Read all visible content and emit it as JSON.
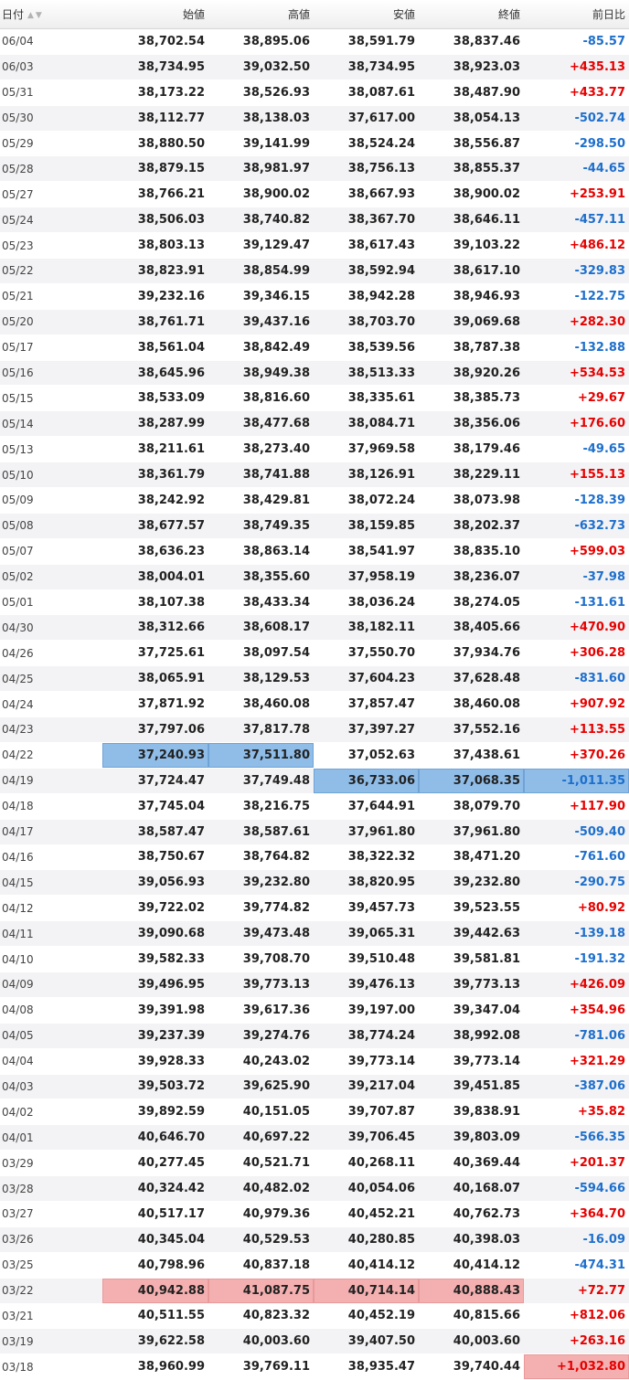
{
  "columns": {
    "date": "日付",
    "open": "始値",
    "high": "高値",
    "low": "安値",
    "close": "終値",
    "change": "前日比"
  },
  "icons": {
    "sort": "sort-up-down-icon"
  },
  "colors": {
    "positive": "#e60000",
    "negative": "#1e6fcc",
    "highlight_blue": "#8fbde8",
    "highlight_red": "#f4b0b0"
  },
  "rows": [
    {
      "date": "06/04",
      "open": "38,702.54",
      "high": "38,895.06",
      "low": "38,591.79",
      "close": "38,837.46",
      "change": "-85.57"
    },
    {
      "date": "06/03",
      "open": "38,734.95",
      "high": "39,032.50",
      "low": "38,734.95",
      "close": "38,923.03",
      "change": "+435.13"
    },
    {
      "date": "05/31",
      "open": "38,173.22",
      "high": "38,526.93",
      "low": "38,087.61",
      "close": "38,487.90",
      "change": "+433.77"
    },
    {
      "date": "05/30",
      "open": "38,112.77",
      "high": "38,138.03",
      "low": "37,617.00",
      "close": "38,054.13",
      "change": "-502.74"
    },
    {
      "date": "05/29",
      "open": "38,880.50",
      "high": "39,141.99",
      "low": "38,524.24",
      "close": "38,556.87",
      "change": "-298.50"
    },
    {
      "date": "05/28",
      "open": "38,879.15",
      "high": "38,981.97",
      "low": "38,756.13",
      "close": "38,855.37",
      "change": "-44.65"
    },
    {
      "date": "05/27",
      "open": "38,766.21",
      "high": "38,900.02",
      "low": "38,667.93",
      "close": "38,900.02",
      "change": "+253.91"
    },
    {
      "date": "05/24",
      "open": "38,506.03",
      "high": "38,740.82",
      "low": "38,367.70",
      "close": "38,646.11",
      "change": "-457.11"
    },
    {
      "date": "05/23",
      "open": "38,803.13",
      "high": "39,129.47",
      "low": "38,617.43",
      "close": "39,103.22",
      "change": "+486.12"
    },
    {
      "date": "05/22",
      "open": "38,823.91",
      "high": "38,854.99",
      "low": "38,592.94",
      "close": "38,617.10",
      "change": "-329.83"
    },
    {
      "date": "05/21",
      "open": "39,232.16",
      "high": "39,346.15",
      "low": "38,942.28",
      "close": "38,946.93",
      "change": "-122.75"
    },
    {
      "date": "05/20",
      "open": "38,761.71",
      "high": "39,437.16",
      "low": "38,703.70",
      "close": "39,069.68",
      "change": "+282.30"
    },
    {
      "date": "05/17",
      "open": "38,561.04",
      "high": "38,842.49",
      "low": "38,539.56",
      "close": "38,787.38",
      "change": "-132.88"
    },
    {
      "date": "05/16",
      "open": "38,645.96",
      "high": "38,949.38",
      "low": "38,513.33",
      "close": "38,920.26",
      "change": "+534.53"
    },
    {
      "date": "05/15",
      "open": "38,533.09",
      "high": "38,816.60",
      "low": "38,335.61",
      "close": "38,385.73",
      "change": "+29.67"
    },
    {
      "date": "05/14",
      "open": "38,287.99",
      "high": "38,477.68",
      "low": "38,084.71",
      "close": "38,356.06",
      "change": "+176.60"
    },
    {
      "date": "05/13",
      "open": "38,211.61",
      "high": "38,273.40",
      "low": "37,969.58",
      "close": "38,179.46",
      "change": "-49.65"
    },
    {
      "date": "05/10",
      "open": "38,361.79",
      "high": "38,741.88",
      "low": "38,126.91",
      "close": "38,229.11",
      "change": "+155.13"
    },
    {
      "date": "05/09",
      "open": "38,242.92",
      "high": "38,429.81",
      "low": "38,072.24",
      "close": "38,073.98",
      "change": "-128.39"
    },
    {
      "date": "05/08",
      "open": "38,677.57",
      "high": "38,749.35",
      "low": "38,159.85",
      "close": "38,202.37",
      "change": "-632.73"
    },
    {
      "date": "05/07",
      "open": "38,636.23",
      "high": "38,863.14",
      "low": "38,541.97",
      "close": "38,835.10",
      "change": "+599.03"
    },
    {
      "date": "05/02",
      "open": "38,004.01",
      "high": "38,355.60",
      "low": "37,958.19",
      "close": "38,236.07",
      "change": "-37.98"
    },
    {
      "date": "05/01",
      "open": "38,107.38",
      "high": "38,433.34",
      "low": "38,036.24",
      "close": "38,274.05",
      "change": "-131.61"
    },
    {
      "date": "04/30",
      "open": "38,312.66",
      "high": "38,608.17",
      "low": "38,182.11",
      "close": "38,405.66",
      "change": "+470.90"
    },
    {
      "date": "04/26",
      "open": "37,725.61",
      "high": "38,097.54",
      "low": "37,550.70",
      "close": "37,934.76",
      "change": "+306.28"
    },
    {
      "date": "04/25",
      "open": "38,065.91",
      "high": "38,129.53",
      "low": "37,604.23",
      "close": "37,628.48",
      "change": "-831.60"
    },
    {
      "date": "04/24",
      "open": "37,871.92",
      "high": "38,460.08",
      "low": "37,857.47",
      "close": "38,460.08",
      "change": "+907.92"
    },
    {
      "date": "04/23",
      "open": "37,797.06",
      "high": "37,817.78",
      "low": "37,397.27",
      "close": "37,552.16",
      "change": "+113.55"
    },
    {
      "date": "04/22",
      "open": "37,240.93",
      "high": "37,511.80",
      "low": "37,052.63",
      "close": "37,438.61",
      "change": "+370.26",
      "hl": {
        "open": "blue",
        "high": "blue"
      }
    },
    {
      "date": "04/19",
      "open": "37,724.47",
      "high": "37,749.48",
      "low": "36,733.06",
      "close": "37,068.35",
      "change": "-1,011.35",
      "hl": {
        "low": "blue",
        "close": "blue",
        "change": "blue"
      }
    },
    {
      "date": "04/18",
      "open": "37,745.04",
      "high": "38,216.75",
      "low": "37,644.91",
      "close": "38,079.70",
      "change": "+117.90"
    },
    {
      "date": "04/17",
      "open": "38,587.47",
      "high": "38,587.61",
      "low": "37,961.80",
      "close": "37,961.80",
      "change": "-509.40"
    },
    {
      "date": "04/16",
      "open": "38,750.67",
      "high": "38,764.82",
      "low": "38,322.32",
      "close": "38,471.20",
      "change": "-761.60"
    },
    {
      "date": "04/15",
      "open": "39,056.93",
      "high": "39,232.80",
      "low": "38,820.95",
      "close": "39,232.80",
      "change": "-290.75"
    },
    {
      "date": "04/12",
      "open": "39,722.02",
      "high": "39,774.82",
      "low": "39,457.73",
      "close": "39,523.55",
      "change": "+80.92"
    },
    {
      "date": "04/11",
      "open": "39,090.68",
      "high": "39,473.48",
      "low": "39,065.31",
      "close": "39,442.63",
      "change": "-139.18"
    },
    {
      "date": "04/10",
      "open": "39,582.33",
      "high": "39,708.70",
      "low": "39,510.48",
      "close": "39,581.81",
      "change": "-191.32"
    },
    {
      "date": "04/09",
      "open": "39,496.95",
      "high": "39,773.13",
      "low": "39,476.13",
      "close": "39,773.13",
      "change": "+426.09"
    },
    {
      "date": "04/08",
      "open": "39,391.98",
      "high": "39,617.36",
      "low": "39,197.00",
      "close": "39,347.04",
      "change": "+354.96"
    },
    {
      "date": "04/05",
      "open": "39,237.39",
      "high": "39,274.76",
      "low": "38,774.24",
      "close": "38,992.08",
      "change": "-781.06"
    },
    {
      "date": "04/04",
      "open": "39,928.33",
      "high": "40,243.02",
      "low": "39,773.14",
      "close": "39,773.14",
      "change": "+321.29"
    },
    {
      "date": "04/03",
      "open": "39,503.72",
      "high": "39,625.90",
      "low": "39,217.04",
      "close": "39,451.85",
      "change": "-387.06"
    },
    {
      "date": "04/02",
      "open": "39,892.59",
      "high": "40,151.05",
      "low": "39,707.87",
      "close": "39,838.91",
      "change": "+35.82"
    },
    {
      "date": "04/01",
      "open": "40,646.70",
      "high": "40,697.22",
      "low": "39,706.45",
      "close": "39,803.09",
      "change": "-566.35"
    },
    {
      "date": "03/29",
      "open": "40,277.45",
      "high": "40,521.71",
      "low": "40,268.11",
      "close": "40,369.44",
      "change": "+201.37"
    },
    {
      "date": "03/28",
      "open": "40,324.42",
      "high": "40,482.02",
      "low": "40,054.06",
      "close": "40,168.07",
      "change": "-594.66"
    },
    {
      "date": "03/27",
      "open": "40,517.17",
      "high": "40,979.36",
      "low": "40,452.21",
      "close": "40,762.73",
      "change": "+364.70"
    },
    {
      "date": "03/26",
      "open": "40,345.04",
      "high": "40,529.53",
      "low": "40,280.85",
      "close": "40,398.03",
      "change": "-16.09"
    },
    {
      "date": "03/25",
      "open": "40,798.96",
      "high": "40,837.18",
      "low": "40,414.12",
      "close": "40,414.12",
      "change": "-474.31"
    },
    {
      "date": "03/22",
      "open": "40,942.88",
      "high": "41,087.75",
      "low": "40,714.14",
      "close": "40,888.43",
      "change": "+72.77",
      "hl": {
        "open": "red",
        "high": "red",
        "low": "red",
        "close": "red"
      }
    },
    {
      "date": "03/21",
      "open": "40,511.55",
      "high": "40,823.32",
      "low": "40,452.19",
      "close": "40,815.66",
      "change": "+812.06"
    },
    {
      "date": "03/19",
      "open": "39,622.58",
      "high": "40,003.60",
      "low": "39,407.50",
      "close": "40,003.60",
      "change": "+263.16"
    },
    {
      "date": "03/18",
      "open": "38,960.99",
      "high": "39,769.11",
      "low": "38,935.47",
      "close": "39,740.44",
      "change": "+1,032.80",
      "hl": {
        "change": "red"
      }
    }
  ]
}
